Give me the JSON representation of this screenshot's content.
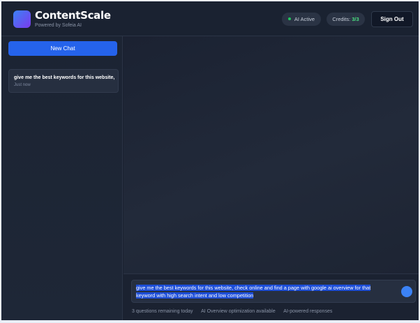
{
  "header": {
    "brand_title": "ContentScale",
    "brand_subtitle": "Powered by Sofeia AI",
    "status_label": "AI Active",
    "credits_label": "Credits:",
    "credits_value": "3/3",
    "sign_out_label": "Sign Out"
  },
  "sidebar": {
    "new_chat_label": "New Chat",
    "chats": [
      {
        "title": "give me the best keywords for this website,",
        "time": "Just now"
      }
    ]
  },
  "composer": {
    "input_value": "give me the best keywords for this website, check online and find a page with google ai overview for that keyword with high search  intent and low competition",
    "footer_items": [
      "3 questions remaining today",
      "AI Overview optimization available",
      "AI-powered responses"
    ]
  },
  "colors": {
    "accent": "#2563eb",
    "status_dot": "#22c55e",
    "credits_value": "#4ade80"
  },
  "icons": {
    "logo": "logo-icon",
    "status": "status-dot-icon",
    "send": "send-icon"
  }
}
